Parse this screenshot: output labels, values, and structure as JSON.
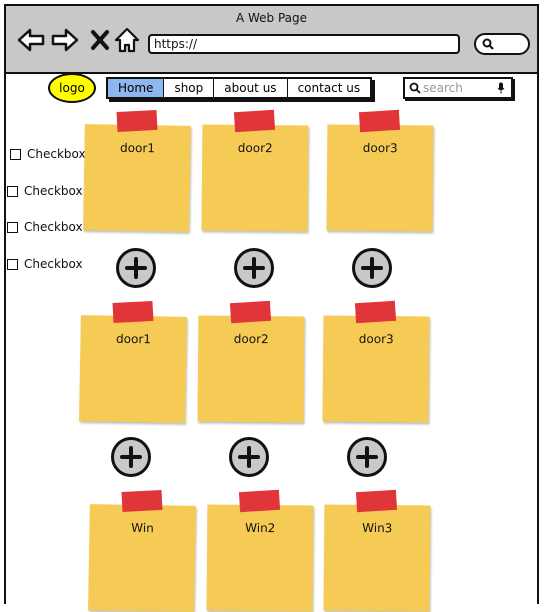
{
  "browser": {
    "title": "A Web Page",
    "url": "https://"
  },
  "header": {
    "logo": "logo",
    "menu": [
      "Home",
      "shop",
      "about us",
      "contact us"
    ],
    "active_menu": "Home",
    "search_placeholder": "search"
  },
  "sidebar": {
    "checkboxes": [
      "Checkbox",
      "Checkbox",
      "Checkbox",
      "Checkbox"
    ]
  },
  "grid": {
    "row1": [
      "door1",
      "door2",
      "door3"
    ],
    "row2": [
      "door1",
      "door2",
      "door3"
    ],
    "row3": [
      "Win",
      "Win2",
      "Win3"
    ]
  },
  "icons": [
    "back-arrow-icon",
    "forward-arrow-icon",
    "close-icon",
    "home-icon",
    "search-icon",
    "microphone-icon",
    "plus-icon"
  ],
  "colors": {
    "logo": "#ffff00",
    "active_tab": "#8db7ee",
    "note": "#f5cb55",
    "tape": "#e0363a",
    "plus": "#c9c9c9"
  }
}
